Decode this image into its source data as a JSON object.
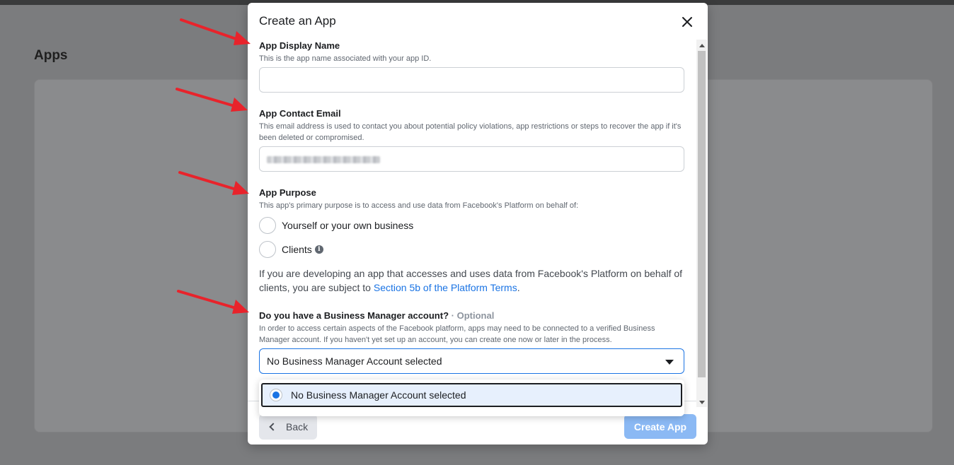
{
  "page": {
    "title": "Apps"
  },
  "modal": {
    "title": "Create an App",
    "display_name": {
      "label": "App Display Name",
      "description": "This is the app name associated with your app ID.",
      "value": ""
    },
    "contact_email": {
      "label": "App Contact Email",
      "description": "This email address is used to contact you about potential policy violations, app restrictions or steps to recover the app if it's been deleted or compromised."
    },
    "purpose": {
      "label": "App Purpose",
      "description": "This app's primary purpose is to access and use data from Facebook's Platform on behalf of:",
      "options": [
        "Yourself or your own business",
        "Clients"
      ],
      "note_prefix": "If you are developing an app that accesses and uses data from Facebook's Platform on behalf of clients, you are subject to ",
      "note_link": "Section 5b of the Platform Terms",
      "note_suffix": "."
    },
    "business_manager": {
      "label": "Do you have a Business Manager account?",
      "optional": "· Optional",
      "description": "In order to access certain aspects of the Facebook platform, apps may need to be connected to a verified Business Manager account. If you haven't yet set up an account, you can create one now or later in the process.",
      "selected": "No Business Manager Account selected",
      "dropdown_options": [
        "No Business Manager Account selected"
      ]
    },
    "footer": {
      "back_label": "Back",
      "create_label": "Create App"
    }
  },
  "colors": {
    "accent": "#1b74e4",
    "arrow": "#e8232b",
    "create_disabled": "#8bb9f4"
  }
}
